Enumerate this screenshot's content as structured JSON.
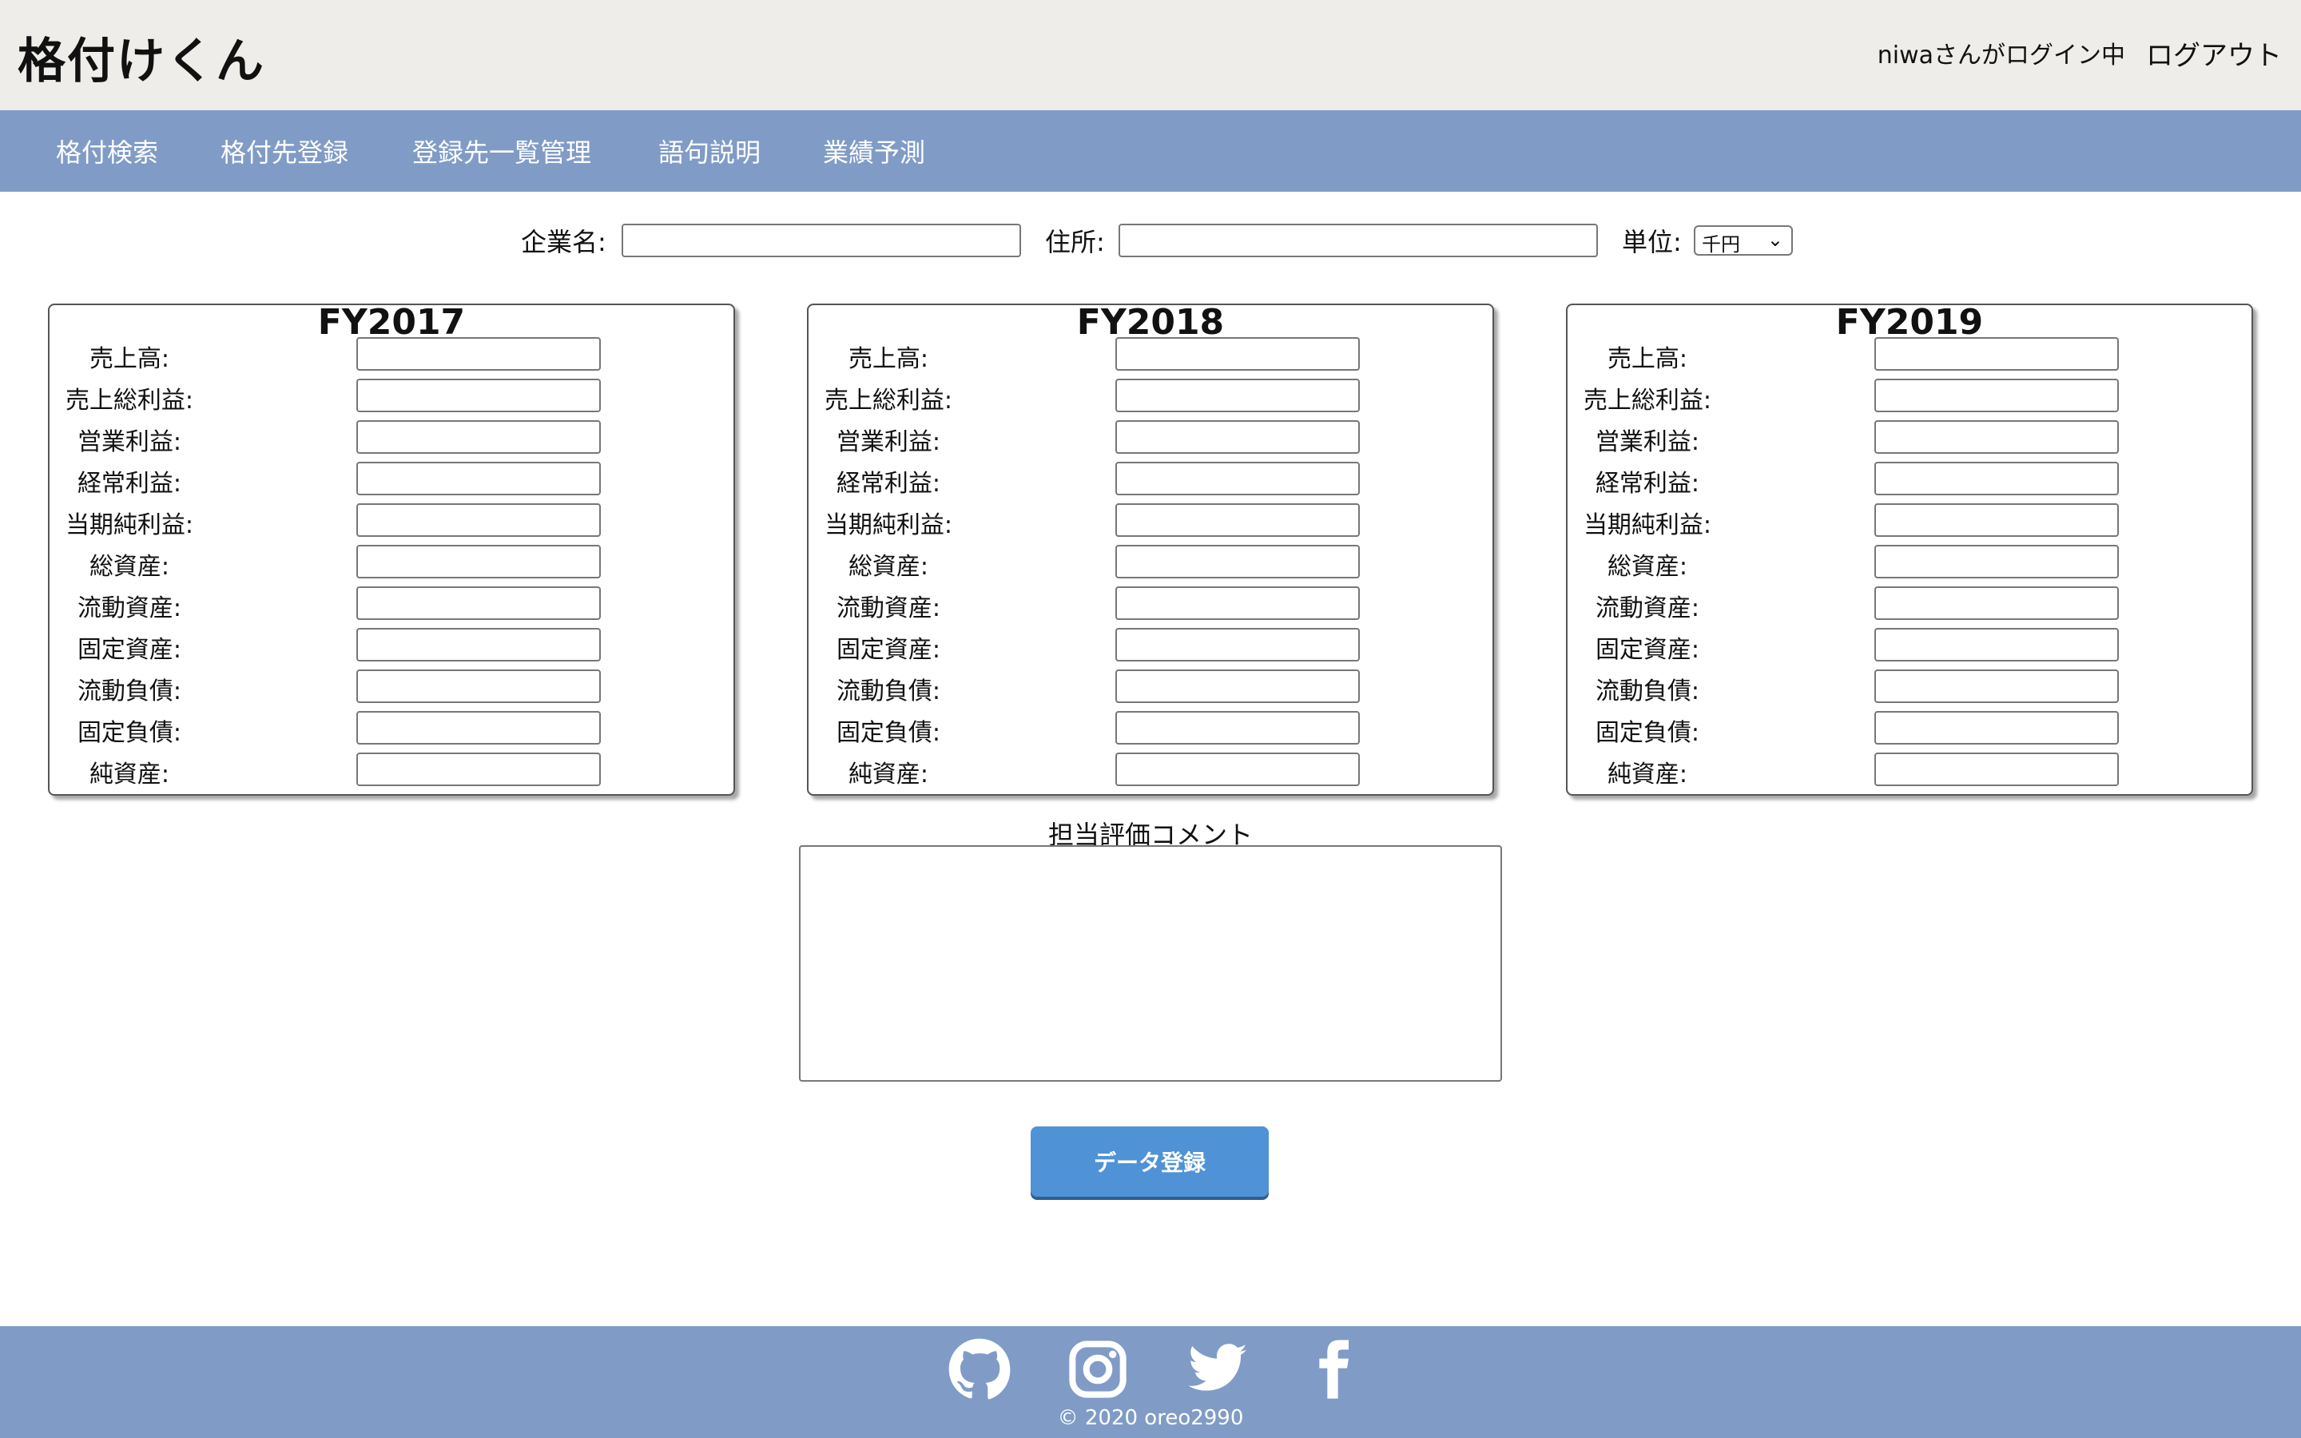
{
  "header": {
    "app_title": "格付けくん",
    "login_status": "niwaさんがログイン中",
    "logout_label": "ログアウト"
  },
  "nav": {
    "items": [
      {
        "label": "格付検索"
      },
      {
        "label": "格付先登録"
      },
      {
        "label": "登録先一覧管理"
      },
      {
        "label": "語句説明"
      },
      {
        "label": "業績予測"
      }
    ]
  },
  "form": {
    "company_label": "企業名:",
    "company_value": "",
    "address_label": "住所:",
    "address_value": "",
    "unit_label": "単位:",
    "unit_selected": "千円"
  },
  "panels": [
    {
      "title": "FY2017"
    },
    {
      "title": "FY2018"
    },
    {
      "title": "FY2019"
    }
  ],
  "row_labels": [
    "売上高:",
    "売上総利益:",
    "営業利益:",
    "経常利益:",
    "当期純利益:",
    "総資産:",
    "流動資産:",
    "固定資産:",
    "流動負債:",
    "固定負債:",
    "純資産:"
  ],
  "comment": {
    "label": "担当評価コメント",
    "value": ""
  },
  "submit_label": "データ登録",
  "footer": {
    "social_icons": [
      "github-icon",
      "instagram-icon",
      "twitter-icon",
      "facebook-icon"
    ],
    "copyright": "© 2020 oreo2990"
  },
  "colors": {
    "header_bg": "#eeede9",
    "nav_bg": "#809cc6",
    "button_bg": "#4f93d6"
  }
}
